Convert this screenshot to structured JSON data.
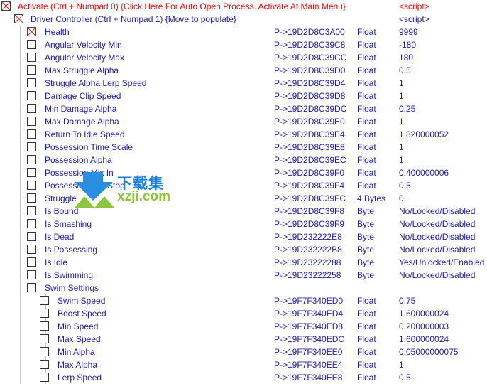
{
  "colors": {
    "text": "#1e1ea0",
    "active": "#f01010"
  },
  "rows": [
    {
      "level": 0,
      "checked": true,
      "red": true,
      "label": "Activate (Ctrl + Numpad 0) {Click Here For Auto Open Process. Activate At Main Menu}",
      "address": "",
      "type": "",
      "value": "<script>"
    },
    {
      "level": 1,
      "checked": true,
      "label": "Driver Controller (Ctrl + Numpad 1) {Move to populate}",
      "address": "",
      "type": "",
      "value": "<script>"
    },
    {
      "level": 2,
      "checked": true,
      "label": "Health",
      "address": "P->19D2D8C3A00",
      "type": "Float",
      "value": "9999"
    },
    {
      "level": 2,
      "label": "Angular Velocity Min",
      "address": "P->19D2D8C39C8",
      "type": "Float",
      "value": "-180"
    },
    {
      "level": 2,
      "label": "Angular Velocity Max",
      "address": "P->19D2D8C39CC",
      "type": "Float",
      "value": "180"
    },
    {
      "level": 2,
      "label": "Max Struggle Alpha",
      "address": "P->19D2D8C39D0",
      "type": "Float",
      "value": "0.5"
    },
    {
      "level": 2,
      "label": "Struggle Alpha Lerp Speed",
      "address": "P->19D2D8C39D4",
      "type": "Float",
      "value": "1"
    },
    {
      "level": 2,
      "label": "Damage Clip Speed",
      "address": "P->19D2D8C39D8",
      "type": "Float",
      "value": "1"
    },
    {
      "level": 2,
      "label": "Min Damage Alpha",
      "address": "P->19D2D8C39DC",
      "type": "Float",
      "value": "0.25"
    },
    {
      "level": 2,
      "label": "Max Damage Alpha",
      "address": "P->19D2D8C39E0",
      "type": "Float",
      "value": "1"
    },
    {
      "level": 2,
      "label": "Return To Idle Speed",
      "address": "P->19D2D8C39E4",
      "type": "Float",
      "value": "1.820000052"
    },
    {
      "level": 2,
      "label": "Possession Time Scale",
      "address": "P->19D2D8C39E8",
      "type": "Float",
      "value": "1"
    },
    {
      "level": 2,
      "label": "Possession Alpha",
      "address": "P->19D2D8C39EC",
      "type": "Float",
      "value": "1"
    },
    {
      "level": 2,
      "label": "Possession Mix In",
      "address": "P->19D2D8C39F0",
      "type": "Float",
      "value": "0.400000006"
    },
    {
      "level": 2,
      "label": "Possession      Into Stop",
      "address": "P->19D2D8C39F4",
      "type": "Float",
      "value": "0.5"
    },
    {
      "level": 2,
      "label": "Struggle",
      "address": "P->19D2D8C39FC",
      "type": "4 Bytes",
      "value": "0"
    },
    {
      "level": 2,
      "label": "Is Bound",
      "address": "P->19D2D8C39F8",
      "type": "Byte",
      "value": "No/Locked/Disabled"
    },
    {
      "level": 2,
      "label": "Is Smashing",
      "address": "P->19D2D8C39F9",
      "type": "Byte",
      "value": "No/Locked/Disabled"
    },
    {
      "level": 2,
      "label": "Is Dead",
      "address": "P->19D232222E8",
      "type": "Byte",
      "value": "No/Locked/Disabled"
    },
    {
      "level": 2,
      "label": "Is Possessing",
      "address": "P->19D232222B8",
      "type": "Byte",
      "value": "No/Locked/Disabled"
    },
    {
      "level": 2,
      "label": "Is Idle",
      "address": "P->19D23222288",
      "type": "Byte",
      "value": "Yes/Unlocked/Enabled"
    },
    {
      "level": 2,
      "label": "Is Swimming",
      "address": "P->19D23222258",
      "type": "Byte",
      "value": "No/Locked/Disabled"
    },
    {
      "level": 2,
      "label": "Swim Settings",
      "address": "",
      "type": "",
      "value": ""
    },
    {
      "level": 3,
      "label": "Swim Speed",
      "address": "P->19F7F340ED0",
      "type": "Float",
      "value": "0.75"
    },
    {
      "level": 3,
      "label": "Boost Speed",
      "address": "P->19F7F340ED4",
      "type": "Float",
      "value": "1.600000024"
    },
    {
      "level": 3,
      "label": "Min Speed",
      "address": "P->19F7F340ED8",
      "type": "Float",
      "value": "0.200000003"
    },
    {
      "level": 3,
      "label": "Max Speed",
      "address": "P->19F7F340EDC",
      "type": "Float",
      "value": "1.600000024"
    },
    {
      "level": 3,
      "label": "Min Alpha",
      "address": "P->19F7F340EE0",
      "type": "Float",
      "value": "0.05000000075"
    },
    {
      "level": 3,
      "label": "Max Alpha",
      "address": "P->19F7F340EE4",
      "type": "Float",
      "value": "1"
    },
    {
      "level": 3,
      "label": "Lerp Speed",
      "address": "P->19F7F340EE8",
      "type": "Float",
      "value": "0.5"
    }
  ],
  "watermark": {
    "text1": "下载集",
    "text2": "xzji.com"
  }
}
